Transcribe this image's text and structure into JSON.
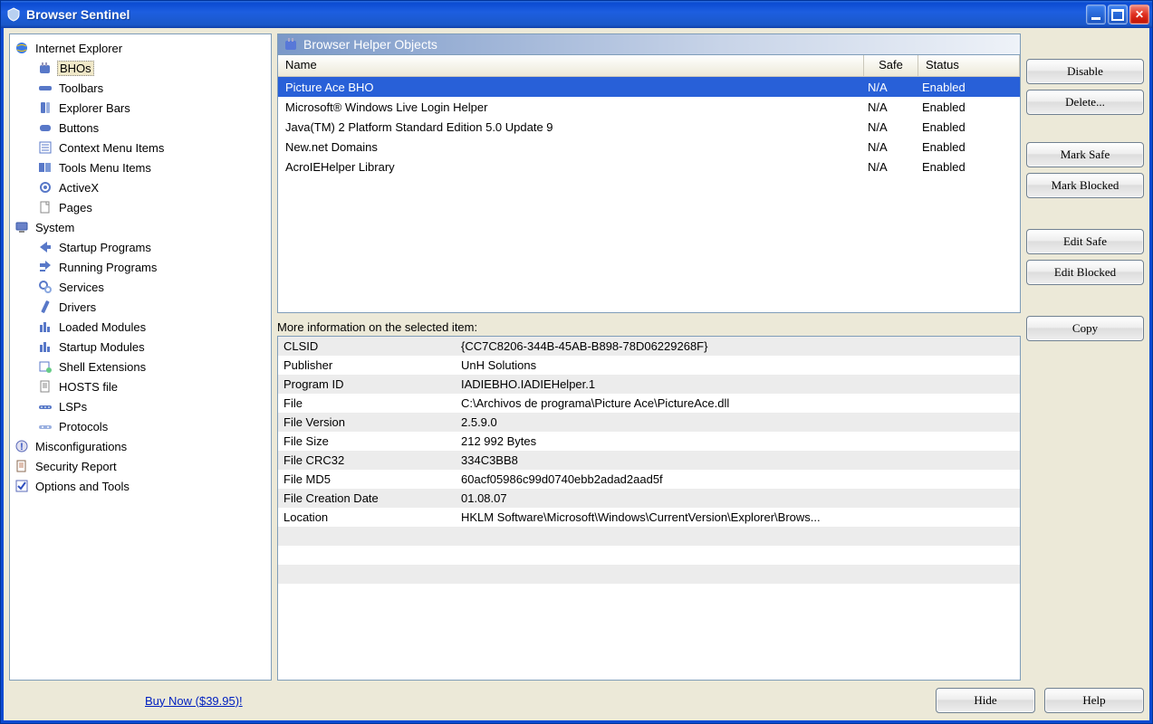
{
  "window": {
    "title": "Browser Sentinel"
  },
  "tree": {
    "ie": {
      "label": "Internet Explorer"
    },
    "ie_children": [
      {
        "id": "bhos",
        "label": "BHOs",
        "selected": true
      },
      {
        "id": "toolbars",
        "label": "Toolbars"
      },
      {
        "id": "explorerbars",
        "label": "Explorer Bars"
      },
      {
        "id": "buttons",
        "label": "Buttons"
      },
      {
        "id": "contextmenu",
        "label": "Context Menu Items"
      },
      {
        "id": "toolsmenu",
        "label": "Tools Menu Items"
      },
      {
        "id": "activex",
        "label": "ActiveX"
      },
      {
        "id": "pages",
        "label": "Pages"
      }
    ],
    "system": {
      "label": "System"
    },
    "system_children": [
      {
        "id": "startup",
        "label": "Startup Programs"
      },
      {
        "id": "running",
        "label": "Running Programs"
      },
      {
        "id": "services",
        "label": "Services"
      },
      {
        "id": "drivers",
        "label": "Drivers"
      },
      {
        "id": "loadedmod",
        "label": "Loaded Modules"
      },
      {
        "id": "startupmod",
        "label": "Startup Modules"
      },
      {
        "id": "shellext",
        "label": "Shell Extensions"
      },
      {
        "id": "hosts",
        "label": "HOSTS file"
      },
      {
        "id": "lsps",
        "label": "LSPs"
      },
      {
        "id": "protocols",
        "label": "Protocols"
      }
    ],
    "misconfig": {
      "label": "Misconfigurations"
    },
    "secreport": {
      "label": "Security Report"
    },
    "options": {
      "label": "Options and Tools"
    }
  },
  "panel": {
    "title": "Browser Helper Objects"
  },
  "list_headers": {
    "name": "Name",
    "safe": "Safe",
    "status": "Status"
  },
  "list": [
    {
      "name": "Picture Ace BHO",
      "safe": "N/A",
      "status": "Enabled",
      "selected": true
    },
    {
      "name": "Microsoft® Windows Live Login Helper",
      "safe": "N/A",
      "status": "Enabled"
    },
    {
      "name": "Java(TM) 2 Platform Standard Edition 5.0 Update 9",
      "safe": "N/A",
      "status": "Enabled"
    },
    {
      "name": "New.net Domains",
      "safe": "N/A",
      "status": "Enabled"
    },
    {
      "name": "AcroIEHelper Library",
      "safe": "N/A",
      "status": "Enabled"
    }
  ],
  "more_info_label": "More information on the selected item:",
  "info": [
    {
      "key": "CLSID",
      "val": "{CC7C8206-344B-45AB-B898-78D06229268F}"
    },
    {
      "key": "Publisher",
      "val": "UnH Solutions"
    },
    {
      "key": "Program ID",
      "val": "IADIEBHO.IADIEHelper.1"
    },
    {
      "key": "File",
      "val": "C:\\Archivos de programa\\Picture Ace\\PictureAce.dll"
    },
    {
      "key": "File Version",
      "val": "2.5.9.0"
    },
    {
      "key": "File Size",
      "val": "212 992 Bytes"
    },
    {
      "key": "File CRC32",
      "val": "334C3BB8"
    },
    {
      "key": "File MD5",
      "val": "60acf05986c99d0740ebb2adad2aad5f"
    },
    {
      "key": "File Creation Date",
      "val": "01.08.07"
    },
    {
      "key": "Location",
      "val": "HKLM Software\\Microsoft\\Windows\\CurrentVersion\\Explorer\\Brows..."
    }
  ],
  "buttons": {
    "disable": "Disable",
    "delete": "Delete...",
    "marksafe": "Mark Safe",
    "markblocked": "Mark Blocked",
    "editsafe": "Edit Safe",
    "editblocked": "Edit Blocked",
    "copy": "Copy"
  },
  "footer": {
    "buy": "Buy Now ($39.95)!",
    "hide": "Hide",
    "help": "Help"
  }
}
